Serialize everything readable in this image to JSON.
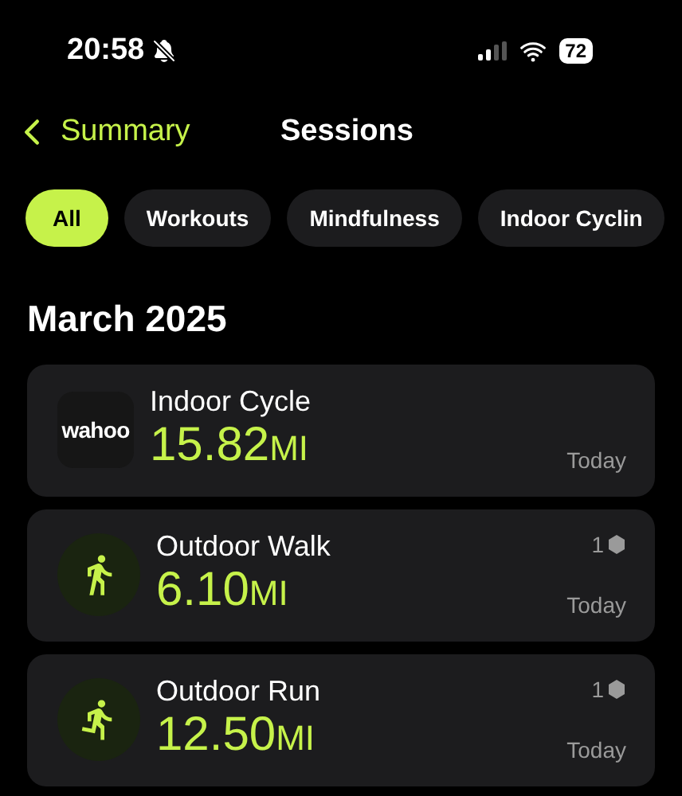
{
  "status_bar": {
    "time": "20:58",
    "silenced": true,
    "battery": "72"
  },
  "nav": {
    "back": "Summary",
    "title": "Sessions"
  },
  "filters": [
    {
      "label": "All",
      "selected": true
    },
    {
      "label": "Workouts",
      "selected": false
    },
    {
      "label": "Mindfulness",
      "selected": false
    },
    {
      "label": "Indoor Cyclin",
      "selected": false
    }
  ],
  "section": "March 2025",
  "sessions": [
    {
      "kind": "logo",
      "logo_text": "wahoo",
      "name": "Indoor Cycle",
      "value": "15.82",
      "unit": "MI",
      "date": "Today"
    },
    {
      "kind": "walk",
      "name": "Outdoor Walk",
      "value": "6.10",
      "unit": "MI",
      "badge": "1",
      "date": "Today"
    },
    {
      "kind": "run",
      "name": "Outdoor Run",
      "value": "12.50",
      "unit": "MI",
      "badge": "1",
      "date": "Today"
    }
  ]
}
